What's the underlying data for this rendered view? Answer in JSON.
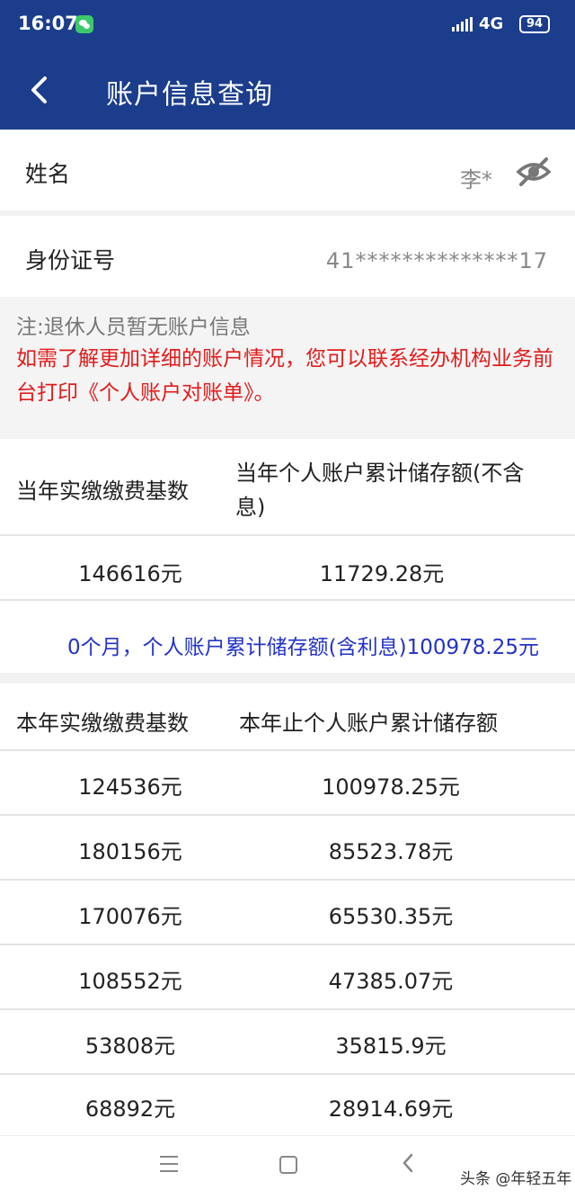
{
  "status_bar": {
    "time": "16:07",
    "network": "4G",
    "battery": "94"
  },
  "app_bar": {
    "title": "账户信息查询",
    "back_icon": "chevron-left-icon"
  },
  "profile": {
    "name_label": "姓名",
    "name_value": "李*",
    "visibility_icon": "eye-off-icon",
    "id_label": "身份证号",
    "id_value": "41**************17"
  },
  "notice": {
    "gray": "注:退休人员暂无账户信息",
    "red": "如需了解更加详细的账户情况，您可以联系经办机构业务前台打印《个人账户对账单》。"
  },
  "current_year": {
    "col1": "当年实缴缴费基数",
    "col2": "当年个人账户累计储存额(不含息)",
    "base": "146616元",
    "balance": "11729.28元"
  },
  "summary_line": "0个月，个人账户累计储存额(含利息)100978.25元",
  "history": {
    "col1": "本年实缴缴费基数",
    "col2": "本年止个人账户累计储存额",
    "rows": [
      {
        "base": "124536元",
        "balance": "100978.25元"
      },
      {
        "base": "180156元",
        "balance": "85523.78元"
      },
      {
        "base": "170076元",
        "balance": "65530.35元"
      },
      {
        "base": "108552元",
        "balance": "47385.07元"
      },
      {
        "base": "53808元",
        "balance": "35815.9元"
      },
      {
        "base": "68892元",
        "balance": "28914.69元"
      }
    ]
  },
  "nav_bar": {
    "menu_icon": "menu-icon",
    "home_icon": "home-icon",
    "back_icon": "back-icon"
  },
  "credit": "头条 @年轻五年"
}
